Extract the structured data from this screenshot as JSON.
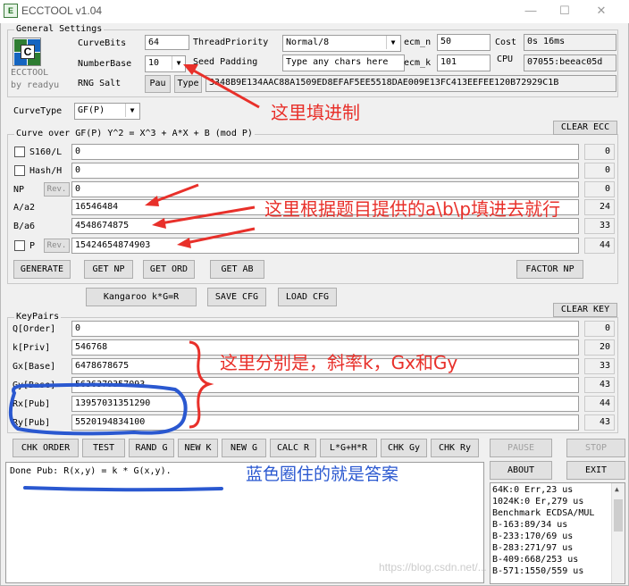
{
  "window": {
    "title": "ECCTOOL v1.04",
    "icon_text": "E"
  },
  "general": {
    "group_label": "General Settings",
    "logo_text": "ECCTOOL",
    "by_text": "by readyu",
    "curvebits_label": "CurveBits",
    "curvebits_value": "64",
    "numberbase_label": "NumberBase",
    "numberbase_value": "10",
    "rngsalt_label": "RNG Salt",
    "pau_label": "Pau",
    "type_label": "Type",
    "salt_value": "3348B9E134AAC88A1509ED8EFAF5EE5518DAE009E13FC413EEFEE120B72929C1B",
    "threadpriority_label": "ThreadPriority",
    "threadpriority_value": "Normal/8",
    "seedpadding_label": "Seed Padding",
    "seedpadding_placeholder": "Type any chars here",
    "ecm_n_label": "ecm_n",
    "ecm_n_value": "50",
    "ecm_k_label": "ecm_k",
    "ecm_k_value": "101",
    "cost_label": "Cost",
    "cost_value": "0s 16ms",
    "cpu_label": "CPU",
    "cpu_value": "07055:beeac05d"
  },
  "curvetype": {
    "label": "CurveType",
    "value": "GF(P)"
  },
  "curve": {
    "group_label": "Curve over GF(P) Y^2 = X^3 + A*X + B (mod P)",
    "clear_label": "CLEAR ECC",
    "rows": [
      {
        "label": "S160/L",
        "value": "0",
        "count": "0"
      },
      {
        "label": "Hash/H",
        "value": "0",
        "count": "0"
      },
      {
        "label": "NP",
        "rev": "Rev.",
        "value": "0",
        "count": "0"
      },
      {
        "label": "A/a2",
        "value": "16546484",
        "count": "24"
      },
      {
        "label": "B/a6",
        "value": "4548674875",
        "count": "33"
      },
      {
        "label": "P",
        "rev": "Rev.",
        "value": "15424654874903",
        "count": "44"
      }
    ],
    "buttons": [
      "GENERATE",
      "GET NP",
      "GET ORD",
      "GET AB",
      "FACTOR NP",
      "Kangaroo k*G=R",
      "SAVE CFG",
      "LOAD CFG"
    ]
  },
  "keypairs": {
    "group_label": "KeyPairs",
    "clear_label": "CLEAR KEY",
    "rows": [
      {
        "label": "Q[Order]",
        "value": "0",
        "count": "0"
      },
      {
        "label": "k[Priv]",
        "value": "546768",
        "count": "20"
      },
      {
        "label": "Gx[Base]",
        "value": "6478678675",
        "count": "33"
      },
      {
        "label": "Gy[Base]",
        "value": "5636379357093",
        "count": "43"
      },
      {
        "label": "Rx[Pub]",
        "value": "13957031351290",
        "count": "44"
      },
      {
        "label": "Ry[Pub]",
        "value": "5520194834100",
        "count": "43"
      }
    ],
    "buttons": [
      "CHK ORDER",
      "TEST",
      "RAND G",
      "NEW K",
      "NEW G",
      "CALC R",
      "L*G+H*R",
      "CHK Gy",
      "CHK Ry"
    ]
  },
  "side_buttons": {
    "pause": "PAUSE",
    "stop": "STOP",
    "about": "ABOUT",
    "exit": "EXIT"
  },
  "output": {
    "text": "Done Pub: R(x,y) = k * G(x,y)."
  },
  "log": [
    "64K:0 Err,23 us",
    "1024K:0 Er,279 us",
    "Benchmark ECDSA/MUL",
    "B-163:89/34 us",
    "B-233:170/69 us",
    "B-283:271/97 us",
    "B-409:668/253 us",
    "B-571:1550/559 us"
  ],
  "annotations": {
    "base": "这里填进制",
    "abp": "这里根据题目提供的a\\b\\p填进去就行",
    "k_gx_gy": "这里分别是，斜率k，Gx和Gy",
    "answer": "蓝色圈住的就是答案"
  },
  "watermark": "https://blog.csdn.net/...",
  "colors": {
    "annotation_red": "#e8302a",
    "annotation_blue": "#2a58d0",
    "window_bg": "#f0f0f0"
  }
}
